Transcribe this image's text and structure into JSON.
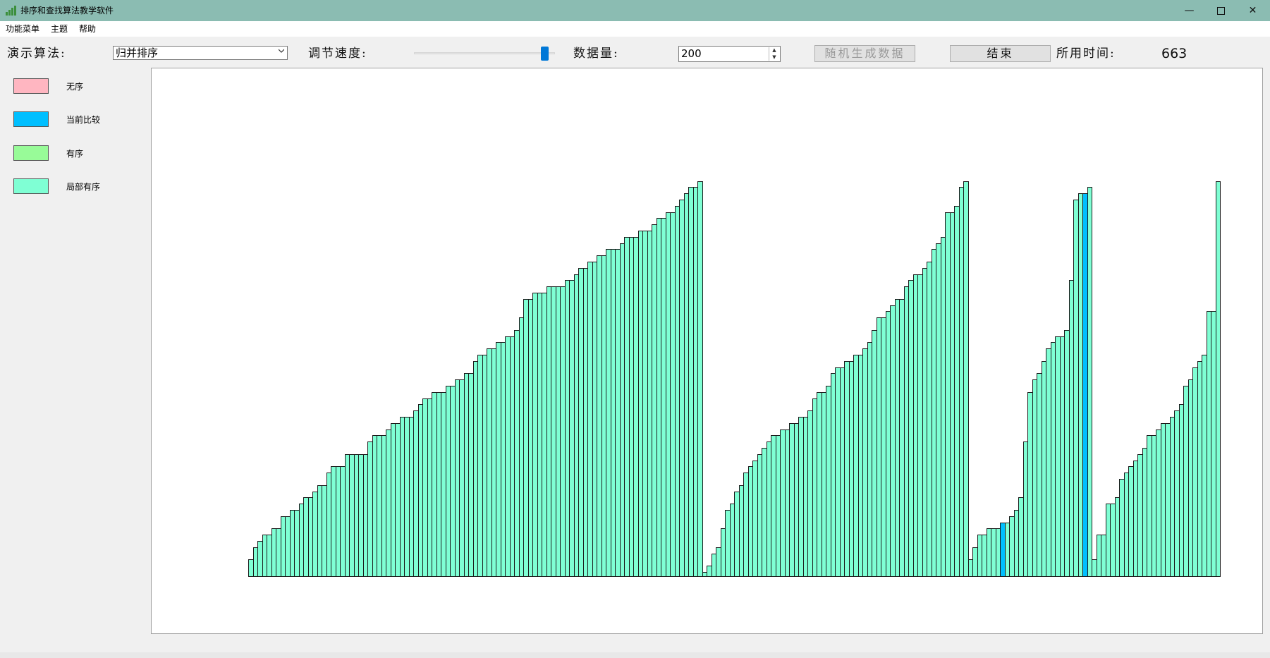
{
  "window": {
    "title": "排序和查找算法教学软件",
    "controls": {
      "minimize": "—",
      "close": "✕"
    }
  },
  "menu": [
    "功能菜单",
    "主题",
    "帮助"
  ],
  "toolbar": {
    "algo_label": "演示算法:",
    "algo_value": "归并排序",
    "speed_label": "调节速度:",
    "speed_level": 0.95,
    "count_label": "数据量:",
    "count_value": "200",
    "random_button": "随机生成数据",
    "end_button": "结束",
    "time_label": "所用时间:",
    "time_value": "663"
  },
  "legend": [
    {
      "label": "无序",
      "color": "#ffb6c1"
    },
    {
      "label": "当前比较",
      "color": "#00bfff"
    },
    {
      "label": "有序",
      "color": "#98fb98"
    },
    {
      "label": "局部有序",
      "color": "#7fffd4"
    }
  ],
  "colors": {
    "titlebar": "#8bbcb2",
    "bar_default": "#7fffd4",
    "bar_compare": "#00bfff",
    "slider_thumb": "#0078d7"
  },
  "chart_data": {
    "type": "bar",
    "compare_indices": [
      164,
      182
    ],
    "values": [
      2,
      4,
      5,
      6,
      6,
      7,
      7,
      9,
      9,
      10,
      10,
      11,
      12,
      12,
      13,
      14,
      14,
      16,
      17,
      17,
      17,
      19,
      19,
      19,
      19,
      19,
      21,
      22,
      22,
      22,
      23,
      24,
      24,
      25,
      25,
      25,
      26,
      27,
      28,
      28,
      29,
      29,
      29,
      30,
      30,
      31,
      31,
      32,
      32,
      34,
      35,
      35,
      36,
      36,
      37,
      37,
      38,
      38,
      39,
      41,
      44,
      44,
      45,
      45,
      45,
      46,
      46,
      46,
      46,
      47,
      47,
      48,
      49,
      49,
      50,
      50,
      51,
      51,
      52,
      52,
      52,
      53,
      54,
      54,
      54,
      55,
      55,
      55,
      56,
      57,
      57,
      58,
      58,
      59,
      60,
      61,
      62,
      62,
      63,
      0,
      1,
      3,
      4,
      7,
      10,
      11,
      13,
      14,
      16,
      17,
      18,
      19,
      20,
      21,
      22,
      22,
      23,
      23,
      24,
      24,
      25,
      25,
      26,
      28,
      29,
      29,
      30,
      32,
      33,
      33,
      34,
      34,
      35,
      35,
      36,
      37,
      39,
      41,
      41,
      42,
      43,
      44,
      44,
      46,
      47,
      48,
      48,
      49,
      50,
      52,
      53,
      54,
      58,
      58,
      59,
      62,
      63,
      2,
      4,
      6,
      6,
      7,
      7,
      7,
      8,
      8,
      9,
      10,
      12,
      21,
      29,
      31,
      32,
      34,
      36,
      37,
      38,
      38,
      39,
      47,
      60,
      61,
      61,
      62,
      2,
      6,
      6,
      11,
      11,
      12,
      15,
      16,
      17,
      18,
      19,
      20,
      22,
      22,
      23,
      24,
      24,
      25,
      26,
      27,
      30,
      31,
      33,
      34,
      35,
      42,
      42,
      63
    ]
  }
}
